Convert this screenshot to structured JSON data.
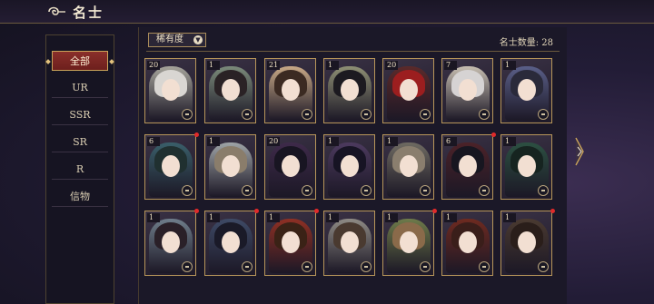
{
  "header": {
    "title": "名士"
  },
  "sidebar": {
    "items": [
      {
        "label": "全部",
        "active": true
      },
      {
        "label": "UR",
        "active": false
      },
      {
        "label": "SSR",
        "active": false
      },
      {
        "label": "SR",
        "active": false
      },
      {
        "label": "R",
        "active": false
      },
      {
        "label": "信物",
        "active": false
      }
    ]
  },
  "toolbar": {
    "filter_label": "稀有度",
    "count_label": "名士数量: 28"
  },
  "cards": [
    {
      "level": "20",
      "hair": "#d9d6d2",
      "bg": "#a5a39a",
      "dot": false
    },
    {
      "level": "1",
      "hair": "#2a2225",
      "bg": "#7b8a7a",
      "dot": false
    },
    {
      "level": "21",
      "hair": "#3b2a22",
      "bg": "#c7a886",
      "dot": false
    },
    {
      "level": "1",
      "hair": "#1c1a20",
      "bg": "#8e8f74",
      "dot": false
    },
    {
      "level": "20",
      "hair": "#9c1e1f",
      "bg": "#5b2a2a",
      "dot": false
    },
    {
      "level": "7",
      "hair": "#d6d3d3",
      "bg": "#c6bdb0",
      "dot": false
    },
    {
      "level": "1",
      "hair": "#2a2a3a",
      "bg": "#5a5f88",
      "dot": false
    },
    {
      "level": "6",
      "hair": "#203030",
      "bg": "#3a5f6a",
      "dot": true
    },
    {
      "level": "1",
      "hair": "#8a7d6b",
      "bg": "#9ea3a6",
      "dot": false
    },
    {
      "level": "20",
      "hair": "#181522",
      "bg": "#3e2a4a",
      "dot": false
    },
    {
      "level": "1",
      "hair": "#171424",
      "bg": "#4c3a5e",
      "dot": false
    },
    {
      "level": "1",
      "hair": "#8a7e6e",
      "bg": "#6e6a62",
      "dot": false
    },
    {
      "level": "6",
      "hair": "#171620",
      "bg": "#4b2228",
      "dot": true
    },
    {
      "level": "1",
      "hair": "#162420",
      "bg": "#2c5042",
      "dot": false
    },
    {
      "level": "1",
      "hair": "#2a2028",
      "bg": "#6f7d8a",
      "dot": true
    },
    {
      "level": "1",
      "hair": "#1a1a28",
      "bg": "#3e4a66",
      "dot": true
    },
    {
      "level": "1",
      "hair": "#3a2216",
      "bg": "#8e3024",
      "dot": true
    },
    {
      "level": "1",
      "hair": "#4a3a30",
      "bg": "#8e8a84",
      "dot": false
    },
    {
      "level": "1",
      "hair": "#8a6a4a",
      "bg": "#6e7a4a",
      "dot": true
    },
    {
      "level": "1",
      "hair": "#3a1e1a",
      "bg": "#6e2a20",
      "dot": false
    },
    {
      "level": "1",
      "hair": "#2a1e1a",
      "bg": "#4a3a30",
      "dot": true
    }
  ],
  "colors": {
    "accent_gold": "#b8965a",
    "active_red": "#8a2f2a",
    "notify_red": "#e02a2a"
  }
}
